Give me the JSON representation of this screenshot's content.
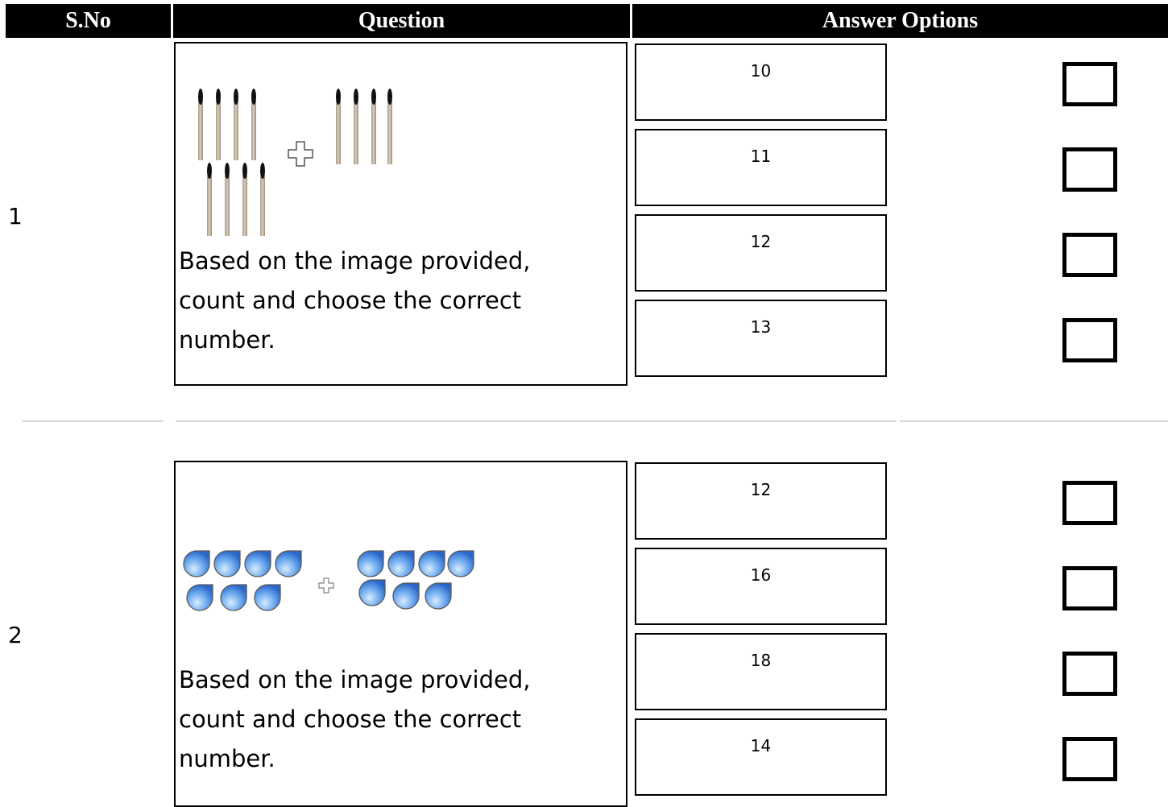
{
  "header": {
    "sno": "S.No",
    "question": "Question",
    "answer_options": "Answer Options"
  },
  "questions": [
    {
      "sno": "1",
      "text": "Based on the image provided, count and choose the correct number.",
      "image_icon": "matchsticks-addition-icon",
      "options": [
        "10",
        "11",
        "12",
        "13"
      ]
    },
    {
      "sno": "2",
      "text": "Based on the image provided, count and choose the correct number.",
      "image_icon": "water-drops-addition-icon",
      "options": [
        "12",
        "16",
        "18",
        "14"
      ]
    }
  ],
  "colors": {
    "header_bg": "#000000",
    "header_text": "#ffffff",
    "border": "#000000",
    "separator": "#d8d8d8",
    "drop_blue": "#4a8fe0",
    "stick_tan": "#c8b9a6"
  }
}
